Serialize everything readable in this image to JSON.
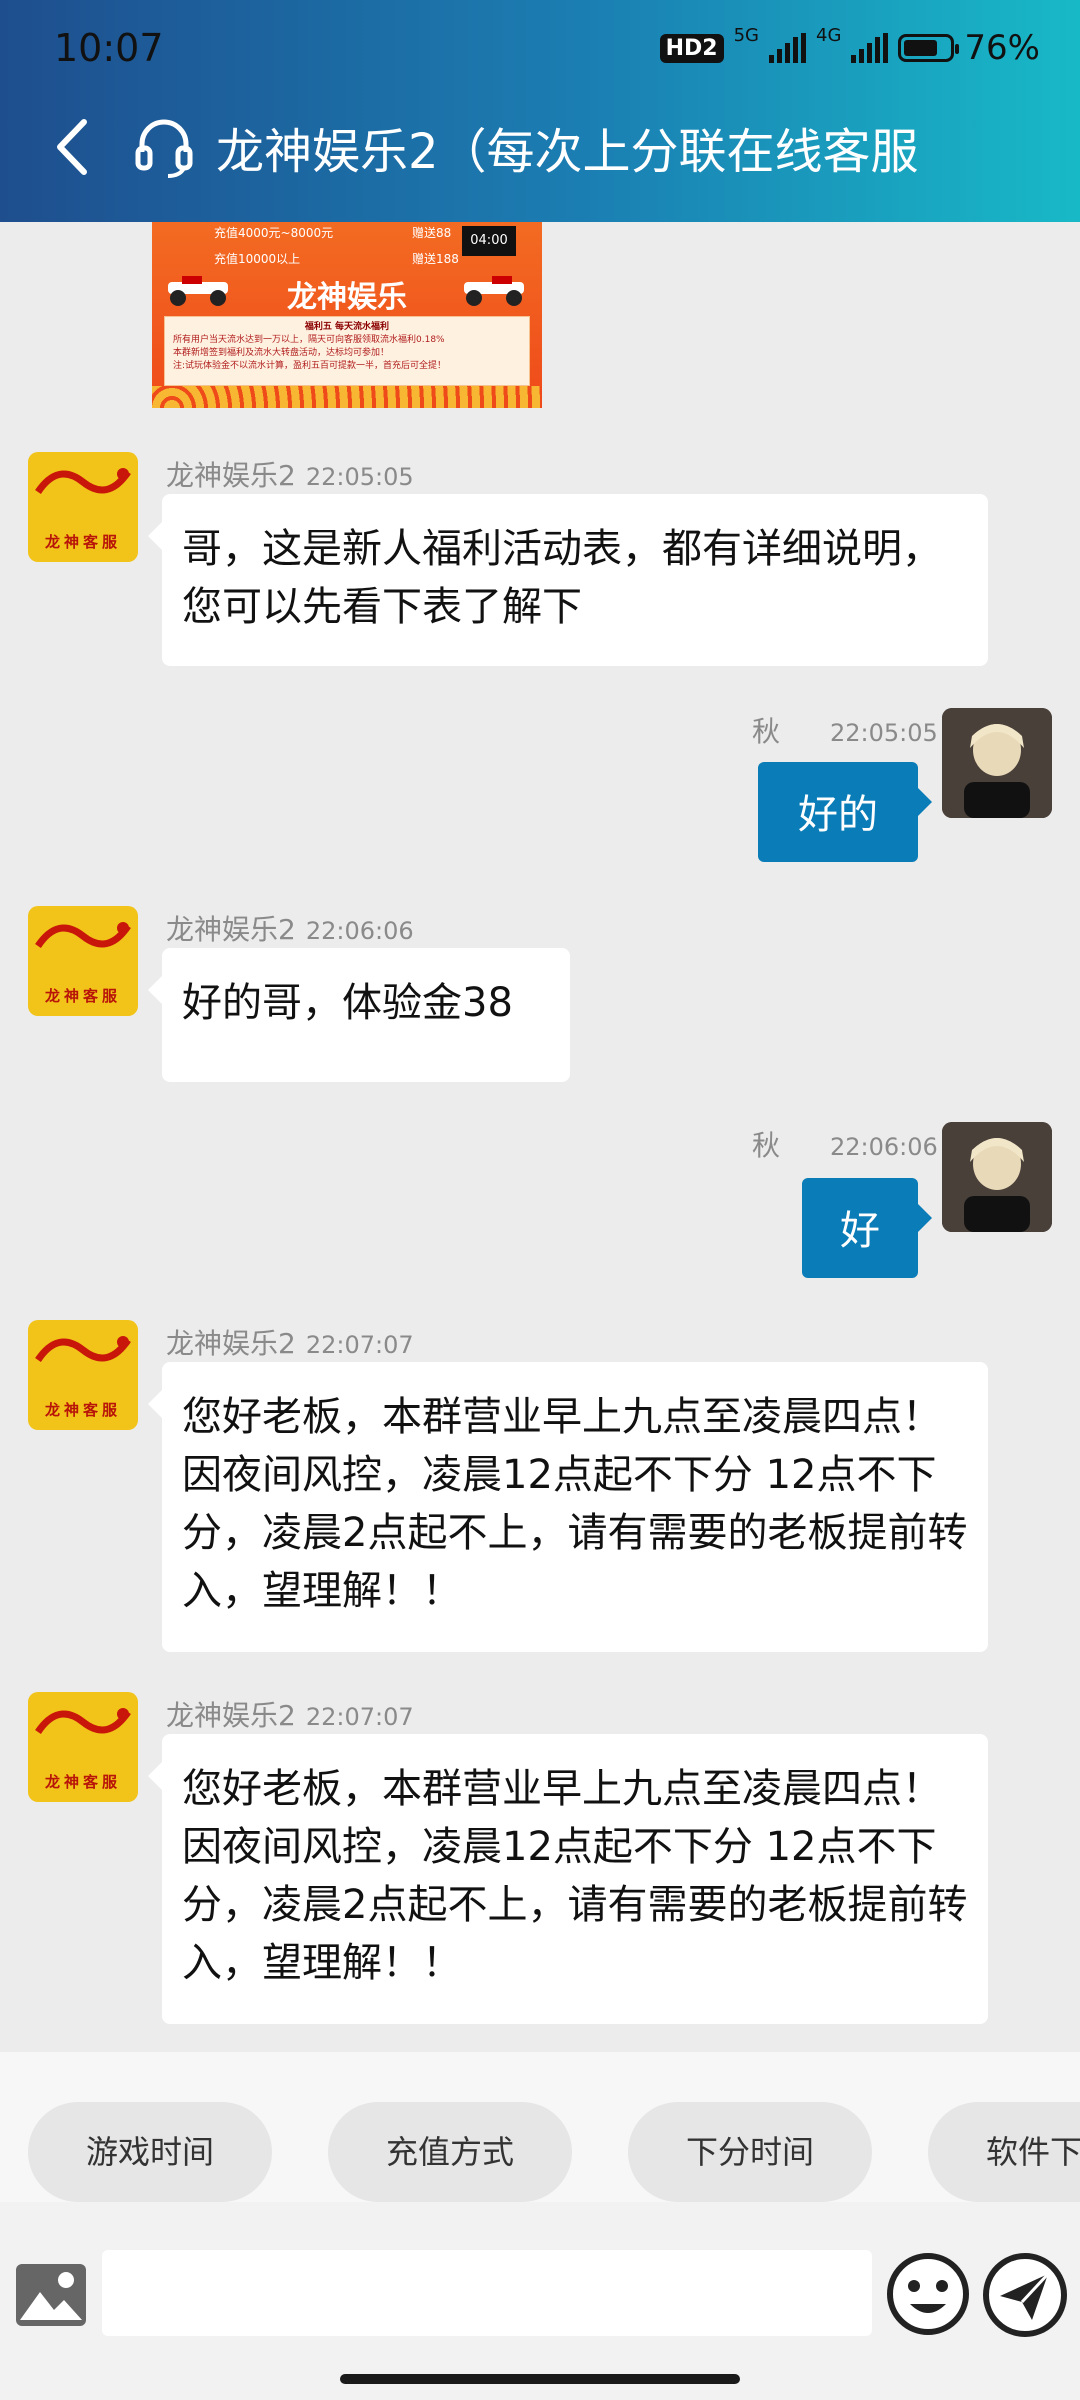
{
  "status_bar": {
    "time": "10:07",
    "hd": "HD2",
    "net1": "5G",
    "net2": "4G",
    "battery_percent": 76,
    "battery_text": "76%"
  },
  "header": {
    "title": "龙神娱乐2（每次上分联在线客服"
  },
  "banner": {
    "line1": "充值4000元~8000元",
    "line2": "充值10000以上",
    "gift1": "赠送88",
    "gift2": "赠送188",
    "clock": "04:00",
    "title": "龙神娱乐",
    "panel_title": "福利五 每天流水福利",
    "panel_line1": "所有用户当天流水达到一万以上，隔天可向客服领取流水福利0.18%",
    "panel_line2": "本群新增签到福利及流水大转盘活动，达标均可参加！",
    "panel_line3": "注:试玩体验金不以流水计算，盈利五百可提款一半，首充后可全提！"
  },
  "messages": [
    {
      "side": "left",
      "name": "龙神娱乐2",
      "time": "22:05:05",
      "text": "哥，这是新人福利活动表，都有详细说明，您可以先看下表了解下",
      "avatar_caption": "龙神客服"
    },
    {
      "side": "right",
      "name": "秋",
      "time": "22:05:05",
      "text": "好的"
    },
    {
      "side": "left",
      "name": "龙神娱乐2",
      "time": "22:06:06",
      "text": "好的哥，体验金38",
      "avatar_caption": "龙神客服"
    },
    {
      "side": "right",
      "name": "秋",
      "time": "22:06:06",
      "text": "好"
    },
    {
      "side": "left",
      "name": "龙神娱乐2",
      "time": "22:07:07",
      "text": "您好老板，本群营业早上九点至凌晨四点！因夜间风控，凌晨12点起不下分 12点不下分，凌晨2点起不上，请有需要的老板提前转入，望理解！！",
      "avatar_caption": "龙神客服"
    },
    {
      "side": "left",
      "name": "龙神娱乐2",
      "time": "22:07:07",
      "text": "您好老板，本群营业早上九点至凌晨四点！因夜间风控，凌晨12点起不下分 12点不下分，凌晨2点起不上，请有需要的老板提前转入，望理解！！",
      "avatar_caption": "龙神客服"
    }
  ],
  "quick_replies": [
    "游戏时间",
    "充值方式",
    "下分时间",
    "软件下"
  ],
  "input": {
    "value": ""
  },
  "colors": {
    "header_start": "#1e4e8e",
    "header_end": "#18b9c7",
    "bubble_right": "#0a7cb7",
    "avatar_bg": "#f2c318"
  }
}
